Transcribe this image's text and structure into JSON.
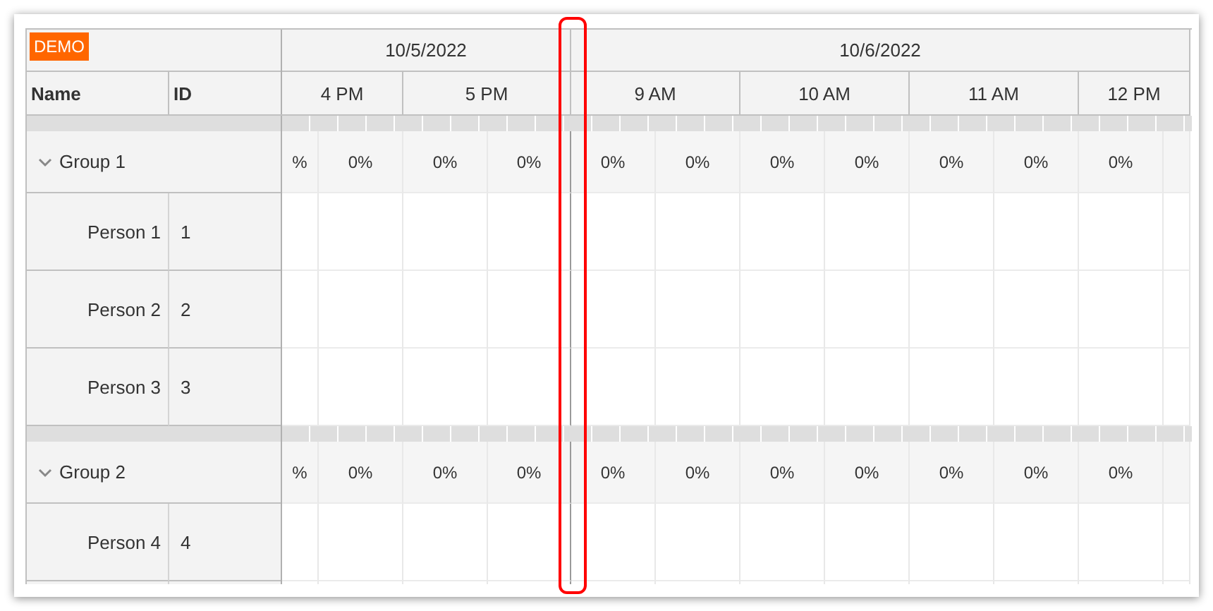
{
  "demo_badge": "DEMO",
  "columns": [
    "Name",
    "ID"
  ],
  "days": [
    "10/5/2022",
    "10/6/2022"
  ],
  "hours": [
    "4 PM",
    "5 PM",
    "9 AM",
    "10 AM",
    "11 AM",
    "12 PM"
  ],
  "groups": [
    {
      "name": "Group 1",
      "expanded": true,
      "loads": [
        "%",
        "0%",
        "0%",
        "0%",
        "0%",
        "0%",
        "0%",
        "0%",
        "0%",
        "0%",
        "0%"
      ],
      "people": [
        {
          "name": "Person 1",
          "id": "1"
        },
        {
          "name": "Person 2",
          "id": "2"
        },
        {
          "name": "Person 3",
          "id": "3"
        }
      ]
    },
    {
      "name": "Group 2",
      "expanded": true,
      "loads": [
        "%",
        "0%",
        "0%",
        "0%",
        "0%",
        "0%",
        "0%",
        "0%",
        "0%",
        "0%",
        "0%"
      ],
      "people": [
        {
          "name": "Person 4",
          "id": "4"
        }
      ]
    }
  ]
}
